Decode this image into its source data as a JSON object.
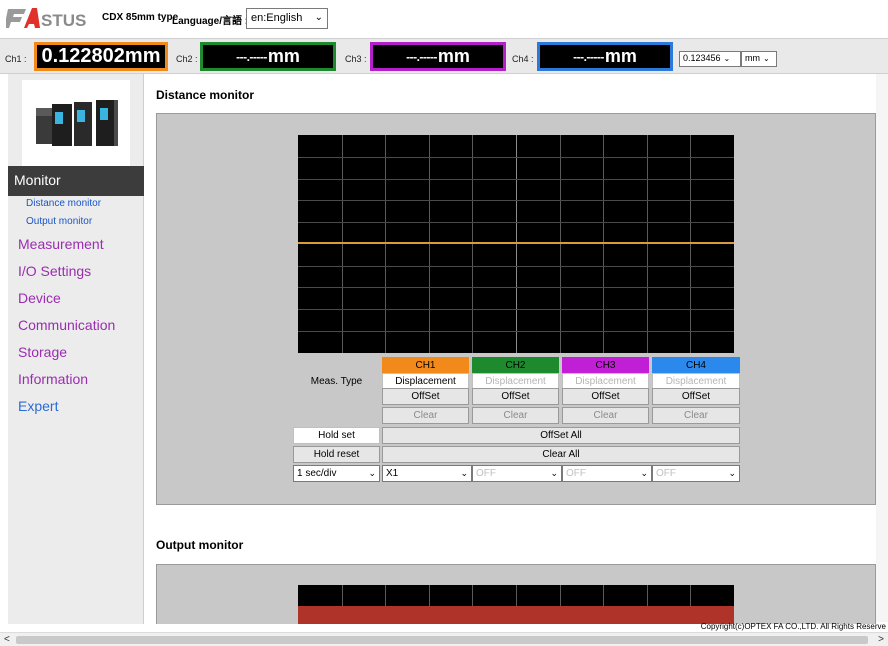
{
  "header": {
    "product_title": "CDX 85mm type",
    "language_label": "Language/言語 :",
    "language_value": "en:English"
  },
  "channels": {
    "ch1": {
      "label": "Ch1 :",
      "value": "0.122802mm"
    },
    "ch2": {
      "label": "Ch2 :",
      "dashes": "---.-----",
      "unit": "mm"
    },
    "ch3": {
      "label": "Ch3 :",
      "dashes": "---.-----",
      "unit": "mm"
    },
    "ch4": {
      "label": "Ch4 :",
      "dashes": "---.-----",
      "unit": "mm"
    },
    "precision_select": "0.123456",
    "unit_select": "mm",
    "colors": {
      "ch1": "#f28a1b",
      "ch2": "#1e8a2e",
      "ch3": "#b51fc9",
      "ch4": "#2b79d8"
    }
  },
  "sidebar": {
    "active": "Monitor",
    "subitems": [
      "Distance monitor",
      "Output monitor"
    ],
    "items": [
      "Measurement",
      "I/O Settings",
      "Device",
      "Communication",
      "Storage",
      "Information",
      "Expert"
    ]
  },
  "distance_monitor": {
    "title": "Distance monitor",
    "channel_headers": [
      "CH1",
      "CH2",
      "CH3",
      "CH4"
    ],
    "meas_type_label": "Meas. Type",
    "meas_types": [
      "Displacement",
      "Displacement",
      "Displacement",
      "Displacement"
    ],
    "offset_label": "OffSet",
    "clear_label": "Clear",
    "hold_set": "Hold set",
    "hold_reset": "Hold reset",
    "offset_all": "OffSet All",
    "clear_all": "Clear All",
    "time_div": "1 sec/div",
    "scale_selects": [
      "X1",
      "OFF",
      "OFF",
      "OFF"
    ]
  },
  "output_monitor": {
    "title": "Output monitor"
  },
  "footer": {
    "copyright": "Copyright(c)OPTEX FA CO.,LTD. All Rights Reserve"
  }
}
